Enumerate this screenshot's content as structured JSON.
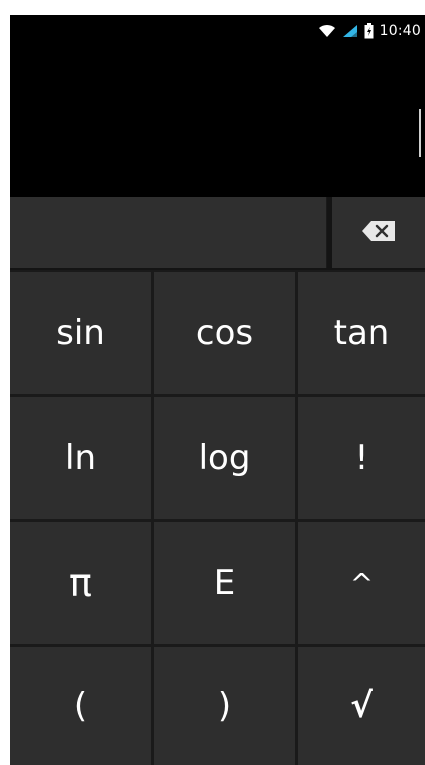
{
  "status_bar": {
    "time": "10:40",
    "icons": [
      "wifi-icon",
      "signal-icon",
      "battery-icon"
    ]
  },
  "display": {
    "expression": ""
  },
  "input": {
    "value": ""
  },
  "backspace": {
    "icon": "backspace-icon"
  },
  "keys": {
    "row1": [
      "sin",
      "cos",
      "tan"
    ],
    "row2": [
      "ln",
      "log",
      "!"
    ],
    "row3": [
      "π",
      "E",
      "^"
    ],
    "row4": [
      "(",
      ")",
      "√"
    ]
  },
  "colors": {
    "background": "#000000",
    "key": "#2e2e2e",
    "key_text": "#ffffff",
    "accent_signal": "#33b5e5"
  }
}
